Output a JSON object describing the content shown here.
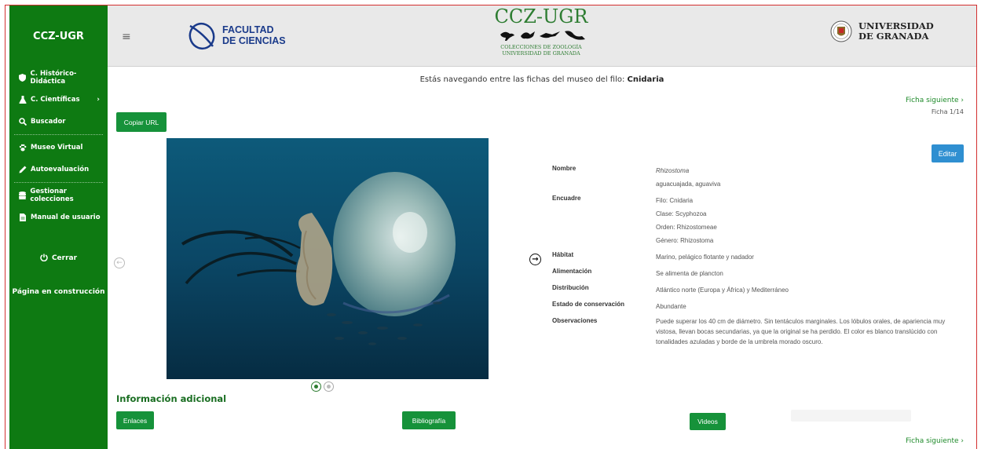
{
  "sidebar": {
    "brand": "CCZ-UGR",
    "items": [
      {
        "label": "C. Histórico-Didáctica",
        "icon": "shield-icon"
      },
      {
        "label": "C. Científicas",
        "icon": "flask-icon"
      },
      {
        "label": "Buscador",
        "icon": "search-icon"
      },
      {
        "label": "Museo Virtual",
        "icon": "paw-icon"
      },
      {
        "label": "Autoevaluación",
        "icon": "pencil-icon"
      },
      {
        "label": "Gestionar colecciones",
        "icon": "database-icon"
      },
      {
        "label": "Manual de usuario",
        "icon": "book-icon"
      }
    ],
    "close_label": "Cerrar",
    "construction": "Página en construcción"
  },
  "header": {
    "faculty_line1": "FACULTAD",
    "faculty_line2": "DE CIENCIAS",
    "ccz_title": "CCZ-UGR",
    "ccz_sub1": "COLECCIONES DE ZOOLOGÍA",
    "ccz_sub2": "UNIVERSIDAD DE GRANADA",
    "ugr_line1": "UNIVERSIDAD",
    "ugr_line2": "DE GRANADA"
  },
  "main": {
    "browsing_prefix": "Estás navegando entre las fichas del museo del filo: ",
    "browsing_phylum": "Cnidaria",
    "next_label": "Ficha siguiente",
    "counter": "Ficha 1/14",
    "copy_url": "Copiar URL",
    "edit": "Editar",
    "details": {
      "nombre_label": "Nombre",
      "nombre_scientific": "Rhizostoma",
      "nombre_common": "aguacuajada, aguaviva",
      "encuadre_label": "Encuadre",
      "filo": "Filo: Cnidaria",
      "clase": "Clase: Scyphozoa",
      "orden": "Orden: Rhizostomeae",
      "genero": "Género: Rhizostoma",
      "habitat_label": "Hábitat",
      "habitat": "Marino, pelágico flotante y nadador",
      "alimentacion_label": "Alimentación",
      "alimentacion": "Se alimenta de plancton",
      "distribucion_label": "Distribución",
      "distribucion": "Atlántico norte (Europa y África) y Mediterráneo",
      "conservacion_label": "Estado de conservación",
      "conservacion": "Abundante",
      "observaciones_label": "Observaciones",
      "observaciones": "Puede superar los 40 cm de diámetro. Sin tentáculos marginales. Los lóbulos orales, de apariencia muy vistosa, llevan bocas secundarias, ya que la original se ha perdido. El color es blanco translúcido con tonalidades azuladas y borde de la umbrela morado oscuro."
    },
    "additional_title": "Información adicional",
    "links_button": "Enlaces",
    "bibliography_button": "Bibliografía",
    "videos_button": "Videos"
  },
  "colors": {
    "sidebar": "#0e7a12",
    "button_green": "#16923a",
    "edit_blue": "#2f8fd1",
    "link_green": "#1e8a2a"
  }
}
